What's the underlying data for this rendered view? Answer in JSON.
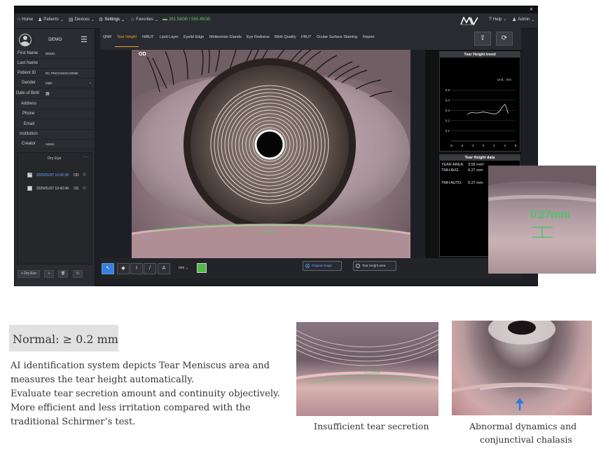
{
  "app": {
    "nav": [
      {
        "icon": "⌂",
        "label": "Home",
        "caret": ""
      },
      {
        "icon": "♟",
        "label": "Patients",
        "caret": "⌄"
      },
      {
        "icon": "▤",
        "label": "Devices",
        "caret": "⌄"
      },
      {
        "icon": "⚙",
        "label": "Settings",
        "caret": "⌄"
      },
      {
        "icon": "☆",
        "label": "Favorites",
        "caret": "⌄"
      }
    ],
    "storage": "261.58GB / 565.49GB",
    "brand": {
      "mark": "MV",
      "sub": "MAGNAMULTI"
    },
    "help": {
      "icon": "?",
      "label": "Help",
      "caret": "⌄"
    },
    "admin": {
      "icon": "♟",
      "label": "Admin",
      "caret": "⌄"
    },
    "close": "×"
  },
  "patient": {
    "name": "DEMO",
    "fields": [
      {
        "label": "First Name",
        "value": "DEMO"
      },
      {
        "label": "Last Name",
        "value": ""
      },
      {
        "label": "Patient ID",
        "value": "RC PROVISION 00095"
      },
      {
        "label": "Gender",
        "value": "Male",
        "caret": "⌄"
      },
      {
        "label": "Date of Birth",
        "value": "",
        "icon": "▦"
      },
      {
        "label": "Address",
        "value": ""
      },
      {
        "label": "Phone",
        "value": ""
      },
      {
        "label": "Email",
        "value": ""
      },
      {
        "label": "Institution",
        "value": ""
      },
      {
        "label": "Creator",
        "value": "Admin"
      }
    ],
    "exam_group": {
      "title": "Dry Eye",
      "more": "···",
      "records": [
        {
          "date": "2025/01/07 10:42:38",
          "eye": "OD",
          "checked": "✓",
          "star": "☆"
        },
        {
          "date": "2025/01/07 10:42:49",
          "eye": "OS",
          "checked": "",
          "star": "☆"
        }
      ]
    },
    "bottom_buttons": [
      {
        "label": "+ Dry Eye"
      },
      {
        "label": "+"
      },
      {
        "label": "🗑"
      },
      {
        "label": "↻"
      }
    ]
  },
  "tabs": [
    {
      "label": "QNR"
    },
    {
      "label": "Tear Height"
    },
    {
      "label": "NIBUT"
    },
    {
      "label": "Lipid Layer"
    },
    {
      "label": "Eyelid Edge"
    },
    {
      "label": "Meibomian Glands"
    },
    {
      "label": "Eye Redness"
    },
    {
      "label": "Blink Quality"
    },
    {
      "label": "FBUT"
    },
    {
      "label": "Ocular Surface Staining"
    },
    {
      "label": "Report"
    }
  ],
  "toolbar_icons": {
    "upload": "⇪",
    "refresh": "⟳"
  },
  "image_view": {
    "eye_label": "OD",
    "meniscus_label": "0.27mm"
  },
  "trend": {
    "title": "Tear Height trend",
    "unit": "Unit：mm",
    "y_ticks": [
      "0.5",
      "0.4",
      "0.3",
      "0.2",
      "0.1"
    ],
    "x_ticks": [
      "-6",
      "-4",
      "-2",
      "0",
      "2",
      "4",
      "6"
    ]
  },
  "tear_data": {
    "title": "Tear Height data",
    "rows": [
      {
        "label": "TEAR AREA:",
        "value": "3.55 mm²"
      },
      {
        "label": "TMH AVG:",
        "value": "0.27 mm"
      },
      {
        "label": "TMH AUTO:",
        "value": "0.27 mm"
      }
    ]
  },
  "bottom_tools": {
    "buttons": [
      "↖",
      "◆",
      "I",
      "/",
      "A"
    ],
    "unit": "mm ⌄",
    "swatch_color": "#52b74a",
    "view_options": [
      {
        "label": "Original image",
        "on": true
      },
      {
        "label": "Tear Height area",
        "on": false
      }
    ]
  },
  "zoom": {
    "reading": "0.27mm"
  },
  "marketing": {
    "normal": "Normal: ≥ 0.2 mm",
    "description": [
      "AI identification system depicts Tear Meniscus area and",
      "measures the tear height automatically.",
      "Evaluate tear secretion amount and continuity objectively.",
      "More efficient and less irritation compared with the",
      "traditional Schirmer’s test."
    ],
    "photo1_label": "0.12mm",
    "caption1": "Insufficient tear secretion",
    "caption2": [
      "Abnormal dynamics and",
      "conjunctival chalasis"
    ]
  },
  "chart_data": {
    "type": "line",
    "title": "Tear Height trend",
    "xlabel": "",
    "ylabel": "",
    "unit": "Unit：mm",
    "xlim": [
      -6,
      6
    ],
    "ylim": [
      0,
      0.55
    ],
    "grid": true,
    "series": [
      {
        "x": [
          -3,
          -2.5,
          -2,
          -1.5,
          -1,
          -0.5,
          0,
          0.5,
          1,
          1.5,
          2,
          2.5,
          3,
          3.5,
          4,
          4.3,
          4.6
        ],
        "y": [
          0.26,
          0.275,
          0.28,
          0.275,
          0.275,
          0.28,
          0.285,
          0.28,
          0.275,
          0.27,
          0.265,
          0.27,
          0.29,
          0.33,
          0.36,
          0.33,
          0.27
        ]
      }
    ]
  }
}
